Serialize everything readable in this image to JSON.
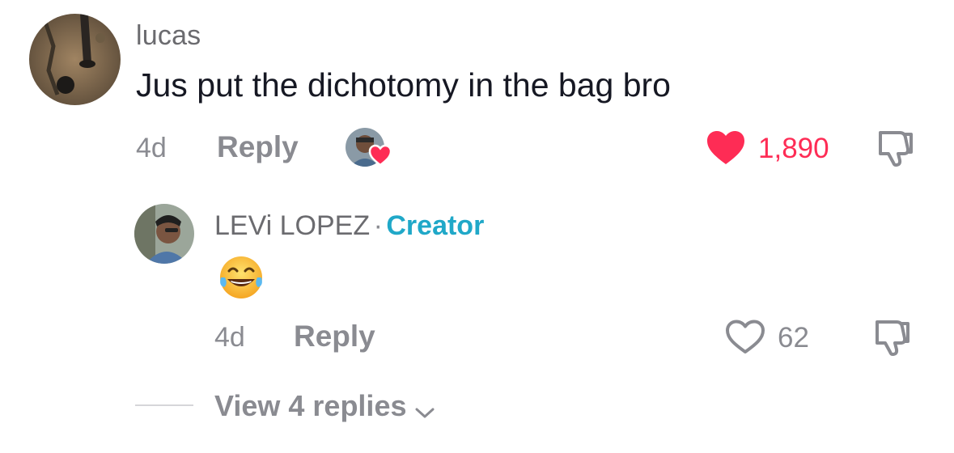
{
  "comment": {
    "username": "lucas",
    "text": "Jus put the dichotomy in the bag bro",
    "time": "4d",
    "reply_label": "Reply",
    "like_count": "1,890",
    "liked": true,
    "creator_liked": true
  },
  "reply": {
    "username": "LEVi LOPEZ",
    "separator": "·",
    "badge": "Creator",
    "emoji": "😂",
    "time": "4d",
    "reply_label": "Reply",
    "like_count": "62",
    "liked": false
  },
  "view_replies": {
    "label": "View 4 replies"
  },
  "colors": {
    "like_active": "#fe2c55",
    "creator_badge": "#20a8c8",
    "muted_text": "#8a8b91"
  },
  "icons": {
    "heart_filled": "heart-filled-icon",
    "heart_outline": "heart-outline-icon",
    "dislike": "thumbs-down-icon",
    "chevron": "chevron-down-icon"
  }
}
